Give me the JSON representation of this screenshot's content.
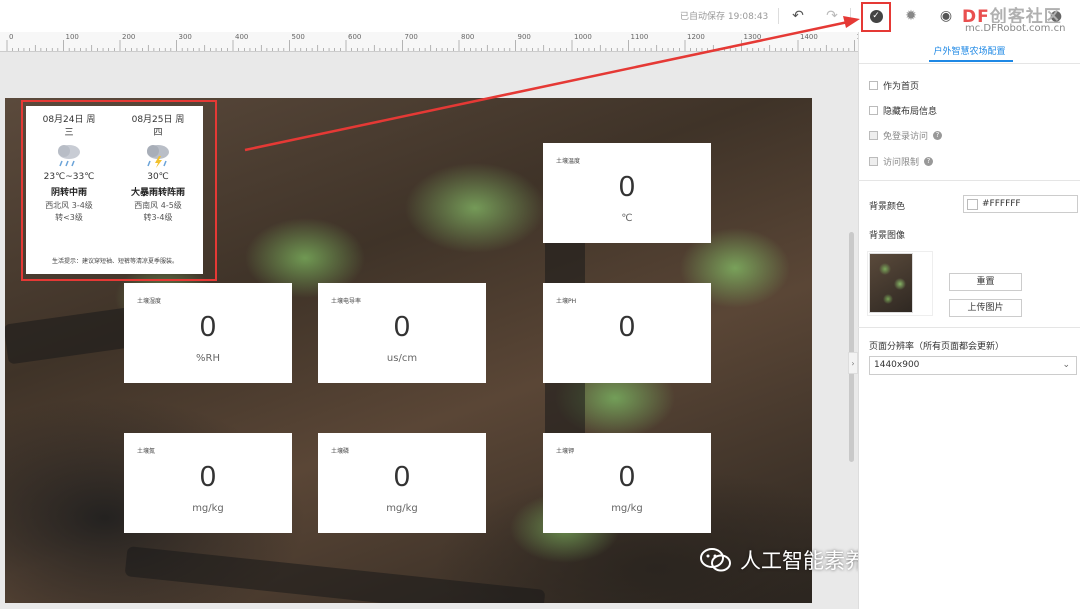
{
  "toolbar": {
    "autosave": "已自动保存 19:08:43",
    "undo_icon": "undo-icon",
    "redo_icon": "redo-icon",
    "save_icon": "check-circle-icon",
    "debug_icon": "bug-icon",
    "preview_icon": "eye-icon",
    "accent_red": "#e53935"
  },
  "brand": {
    "logo_df": "DF",
    "logo_text": "创客社区",
    "url": "mc.DFRobot.com.cn"
  },
  "ruler": {
    "labels": [
      "0",
      "100",
      "200",
      "300",
      "400",
      "500",
      "600",
      "700",
      "800",
      "900",
      "1000",
      "1100",
      "1200",
      "1300",
      "1400",
      "15"
    ]
  },
  "weather": {
    "days": [
      {
        "date": "08月24日 周\n三",
        "icon": "rain-cloud-icon",
        "temp": "23℃~33℃",
        "desc": "阴转中雨",
        "wind": "西北风 3-4级\n转<3级"
      },
      {
        "date": "08月25日 周\n四",
        "icon": "thunderstorm-cloud-icon",
        "temp": "30℃",
        "desc": "大暴雨转阵雨",
        "wind": "西南风 4-5级\n转3-4级"
      }
    ],
    "tip": "生活提示：建议穿短袖、短裤等清凉夏季服装。"
  },
  "cards": [
    {
      "label": "土壤温度",
      "value": "0",
      "unit": "℃"
    },
    {
      "label": "土壤湿度",
      "value": "0",
      "unit": "%RH"
    },
    {
      "label": "土壤电导率",
      "value": "0",
      "unit": "us/cm"
    },
    {
      "label": "土壤PH",
      "value": "0",
      "unit": ""
    },
    {
      "label": "土壤氮",
      "value": "0",
      "unit": "mg/kg"
    },
    {
      "label": "土壤磷",
      "value": "0",
      "unit": "mg/kg"
    },
    {
      "label": "土壤钾",
      "value": "0",
      "unit": "mg/kg"
    }
  ],
  "watermark": {
    "icon": "wechat-icon",
    "text": "人工智能素养教育共同体"
  },
  "panel": {
    "title": "户外智慧农场配置",
    "checkboxes": [
      {
        "label": "作为首页",
        "checked": false,
        "disabled": false,
        "help": false
      },
      {
        "label": "隐藏布局信息",
        "checked": false,
        "disabled": false,
        "help": false
      },
      {
        "label": "免登录访问",
        "checked": false,
        "disabled": true,
        "help": true
      },
      {
        "label": "访问限制",
        "checked": false,
        "disabled": true,
        "help": true
      }
    ],
    "bg_color_label": "背景颜色",
    "bg_color_value": "#FFFFFF",
    "bg_image_label": "背景图像",
    "reset_button": "重置",
    "upload_button": "上传图片",
    "resolution_label": "页面分辨率（所有页面都会更新）",
    "resolution_value": "1440x900"
  }
}
